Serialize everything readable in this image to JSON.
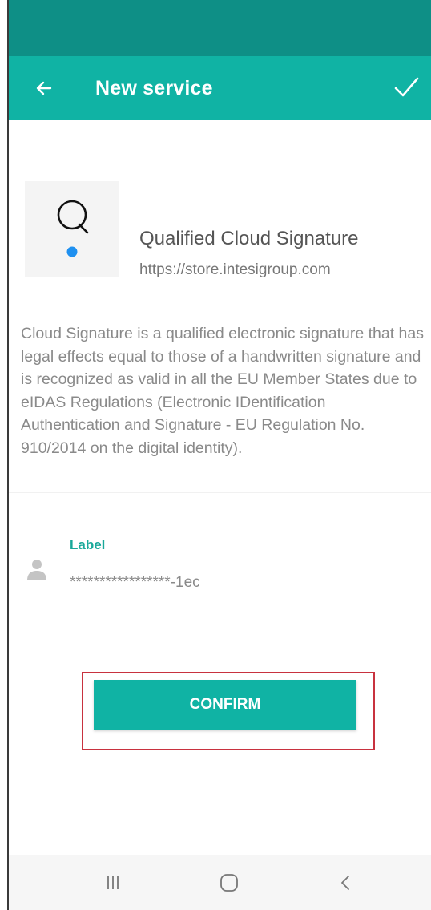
{
  "app_bar": {
    "title": "New service",
    "back_icon": "arrow-left-icon",
    "confirm_icon": "checkmark-icon"
  },
  "service": {
    "logo_letter": "Q",
    "name": "Qualified Cloud Signature",
    "url": "https://store.intesigroup.com"
  },
  "description": "Cloud Signature is a qualified electronic signature that has legal effects equal to those of a handwritten signature and is recognized as valid in all the EU Member States due to eIDAS Regulations (Electronic IDentification Authentication and Signature - EU Regulation No. 910/2014 on the digital identity).",
  "form": {
    "label_title": "Label",
    "label_value": "*****************-1ec",
    "icon": "person-icon"
  },
  "confirm_label": "CONFIRM",
  "nav": {
    "recents_icon": "recents-icon",
    "home_icon": "home-icon",
    "back_icon": "back-chevron-icon"
  },
  "colors": {
    "status_bar": "#0e8f86",
    "app_bar": "#10b3a4",
    "accent": "#19a89a",
    "logo_dot": "#1e90f0",
    "highlight": "#c8323f"
  }
}
